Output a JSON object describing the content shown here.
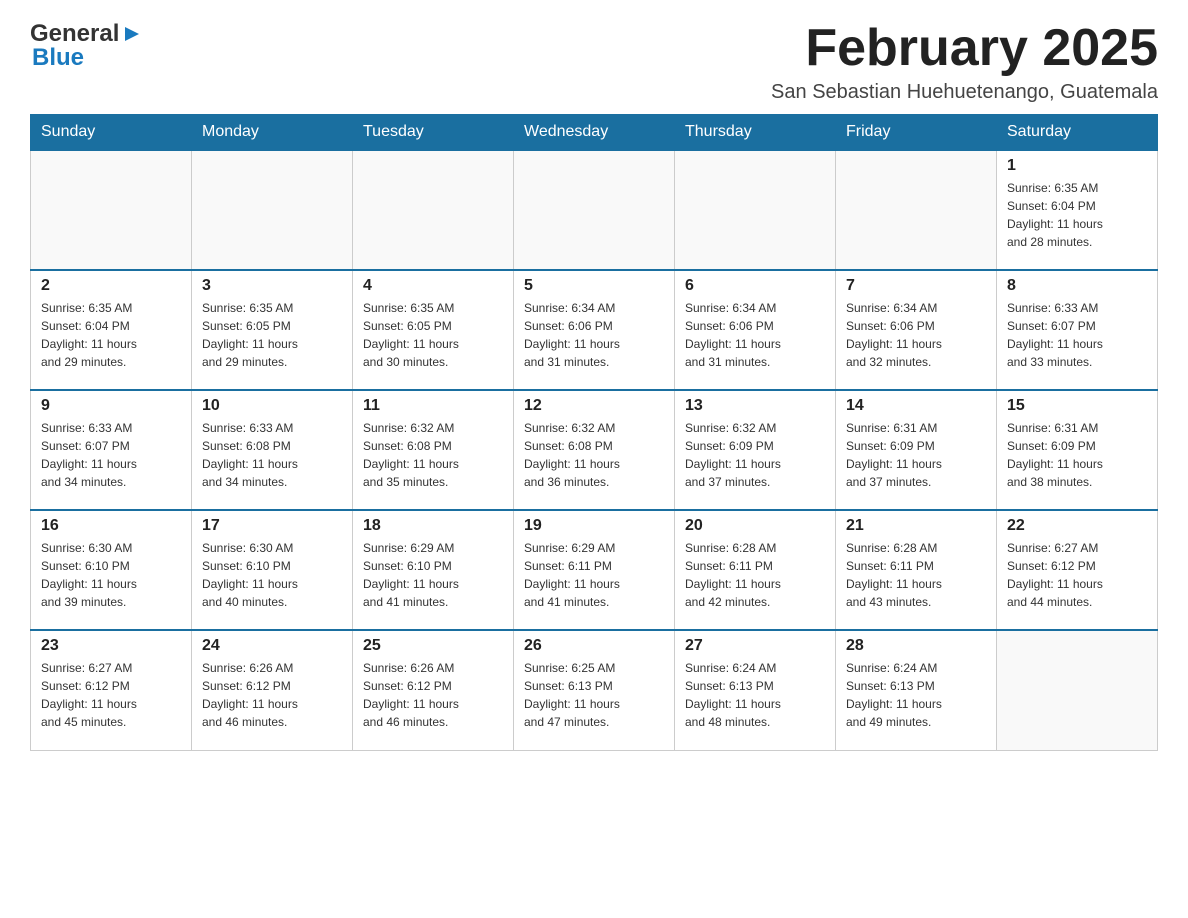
{
  "header": {
    "logo_line1": "General",
    "logo_line2": "Blue",
    "title": "February 2025",
    "subtitle": "San Sebastian Huehuetenango, Guatemala"
  },
  "days_of_week": [
    "Sunday",
    "Monday",
    "Tuesday",
    "Wednesday",
    "Thursday",
    "Friday",
    "Saturday"
  ],
  "weeks": [
    {
      "days": [
        {
          "number": "",
          "info": ""
        },
        {
          "number": "",
          "info": ""
        },
        {
          "number": "",
          "info": ""
        },
        {
          "number": "",
          "info": ""
        },
        {
          "number": "",
          "info": ""
        },
        {
          "number": "",
          "info": ""
        },
        {
          "number": "1",
          "info": "Sunrise: 6:35 AM\nSunset: 6:04 PM\nDaylight: 11 hours\nand 28 minutes."
        }
      ]
    },
    {
      "days": [
        {
          "number": "2",
          "info": "Sunrise: 6:35 AM\nSunset: 6:04 PM\nDaylight: 11 hours\nand 29 minutes."
        },
        {
          "number": "3",
          "info": "Sunrise: 6:35 AM\nSunset: 6:05 PM\nDaylight: 11 hours\nand 29 minutes."
        },
        {
          "number": "4",
          "info": "Sunrise: 6:35 AM\nSunset: 6:05 PM\nDaylight: 11 hours\nand 30 minutes."
        },
        {
          "number": "5",
          "info": "Sunrise: 6:34 AM\nSunset: 6:06 PM\nDaylight: 11 hours\nand 31 minutes."
        },
        {
          "number": "6",
          "info": "Sunrise: 6:34 AM\nSunset: 6:06 PM\nDaylight: 11 hours\nand 31 minutes."
        },
        {
          "number": "7",
          "info": "Sunrise: 6:34 AM\nSunset: 6:06 PM\nDaylight: 11 hours\nand 32 minutes."
        },
        {
          "number": "8",
          "info": "Sunrise: 6:33 AM\nSunset: 6:07 PM\nDaylight: 11 hours\nand 33 minutes."
        }
      ]
    },
    {
      "days": [
        {
          "number": "9",
          "info": "Sunrise: 6:33 AM\nSunset: 6:07 PM\nDaylight: 11 hours\nand 34 minutes."
        },
        {
          "number": "10",
          "info": "Sunrise: 6:33 AM\nSunset: 6:08 PM\nDaylight: 11 hours\nand 34 minutes."
        },
        {
          "number": "11",
          "info": "Sunrise: 6:32 AM\nSunset: 6:08 PM\nDaylight: 11 hours\nand 35 minutes."
        },
        {
          "number": "12",
          "info": "Sunrise: 6:32 AM\nSunset: 6:08 PM\nDaylight: 11 hours\nand 36 minutes."
        },
        {
          "number": "13",
          "info": "Sunrise: 6:32 AM\nSunset: 6:09 PM\nDaylight: 11 hours\nand 37 minutes."
        },
        {
          "number": "14",
          "info": "Sunrise: 6:31 AM\nSunset: 6:09 PM\nDaylight: 11 hours\nand 37 minutes."
        },
        {
          "number": "15",
          "info": "Sunrise: 6:31 AM\nSunset: 6:09 PM\nDaylight: 11 hours\nand 38 minutes."
        }
      ]
    },
    {
      "days": [
        {
          "number": "16",
          "info": "Sunrise: 6:30 AM\nSunset: 6:10 PM\nDaylight: 11 hours\nand 39 minutes."
        },
        {
          "number": "17",
          "info": "Sunrise: 6:30 AM\nSunset: 6:10 PM\nDaylight: 11 hours\nand 40 minutes."
        },
        {
          "number": "18",
          "info": "Sunrise: 6:29 AM\nSunset: 6:10 PM\nDaylight: 11 hours\nand 41 minutes."
        },
        {
          "number": "19",
          "info": "Sunrise: 6:29 AM\nSunset: 6:11 PM\nDaylight: 11 hours\nand 41 minutes."
        },
        {
          "number": "20",
          "info": "Sunrise: 6:28 AM\nSunset: 6:11 PM\nDaylight: 11 hours\nand 42 minutes."
        },
        {
          "number": "21",
          "info": "Sunrise: 6:28 AM\nSunset: 6:11 PM\nDaylight: 11 hours\nand 43 minutes."
        },
        {
          "number": "22",
          "info": "Sunrise: 6:27 AM\nSunset: 6:12 PM\nDaylight: 11 hours\nand 44 minutes."
        }
      ]
    },
    {
      "days": [
        {
          "number": "23",
          "info": "Sunrise: 6:27 AM\nSunset: 6:12 PM\nDaylight: 11 hours\nand 45 minutes."
        },
        {
          "number": "24",
          "info": "Sunrise: 6:26 AM\nSunset: 6:12 PM\nDaylight: 11 hours\nand 46 minutes."
        },
        {
          "number": "25",
          "info": "Sunrise: 6:26 AM\nSunset: 6:12 PM\nDaylight: 11 hours\nand 46 minutes."
        },
        {
          "number": "26",
          "info": "Sunrise: 6:25 AM\nSunset: 6:13 PM\nDaylight: 11 hours\nand 47 minutes."
        },
        {
          "number": "27",
          "info": "Sunrise: 6:24 AM\nSunset: 6:13 PM\nDaylight: 11 hours\nand 48 minutes."
        },
        {
          "number": "28",
          "info": "Sunrise: 6:24 AM\nSunset: 6:13 PM\nDaylight: 11 hours\nand 49 minutes."
        },
        {
          "number": "",
          "info": ""
        }
      ]
    }
  ]
}
